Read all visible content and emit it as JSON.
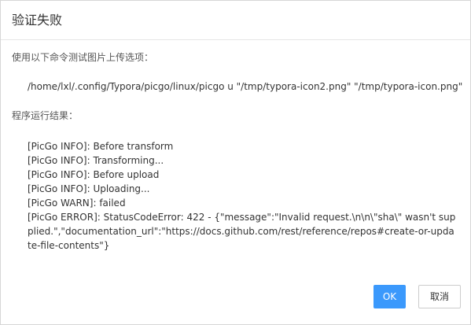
{
  "dialog": {
    "title": "验证失败",
    "command_label": "使用以下命令测试图片上传选项：",
    "command": "/home/lxl/.config/Typora/picgo/linux/picgo u \"/tmp/typora-icon2.png\" \"/tmp/typora-icon.png\"",
    "result_label": "程序运行结果：",
    "log": [
      "[PicGo INFO]: Before transform",
      "[PicGo INFO]: Transforming...",
      "[PicGo INFO]: Before upload",
      "[PicGo INFO]: Uploading...",
      "[PicGo WARN]: failed",
      "[PicGo ERROR]: StatusCodeError: 422 - {\"message\":\"Invalid request.\\n\\n\\\"sha\\\" wasn't supplied.\",\"documentation_url\":\"https://docs.github.com/rest/reference/repos#create-or-update-file-contents\"}"
    ]
  },
  "footer": {
    "ok_label": "OK",
    "cancel_label": "取消"
  },
  "colors": {
    "primary_button": "#3b99fc",
    "text": "#333333"
  }
}
